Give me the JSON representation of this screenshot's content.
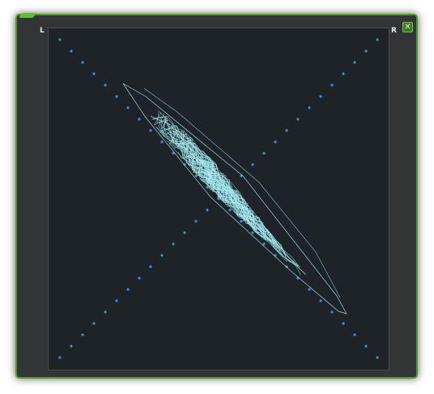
{
  "window": {
    "left_channel_label": "L",
    "right_channel_label": "R",
    "close_glyph": "✕",
    "close_icon": "close-icon"
  },
  "colors": {
    "frame_border": "#4d9a27",
    "window_bg": "#333436",
    "scope_bg": "#1d2326",
    "guide_dot": "#3f8fd8",
    "trace": "#a6ecf2"
  }
}
